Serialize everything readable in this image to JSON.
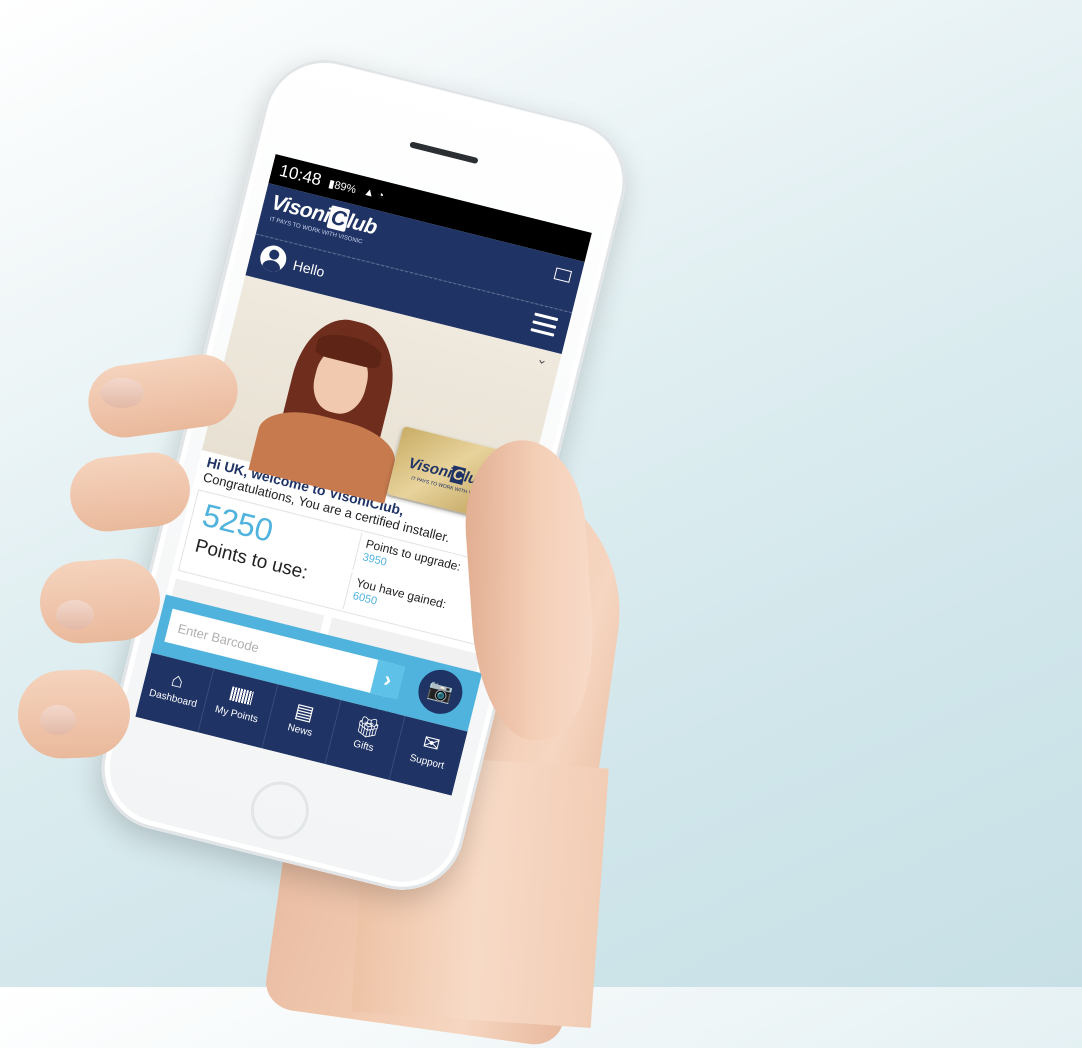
{
  "status_bar": {
    "time": "10:48",
    "battery": "89%"
  },
  "app": {
    "logo_pre": "Visoni",
    "logo_c": "C",
    "logo_post": "lub",
    "tagline": "IT PAYS TO WORK WITH VISONIC"
  },
  "header": {
    "greeting": "Hello"
  },
  "card": {
    "logo_pre": "Visoni",
    "logo_c": "C",
    "logo_post": "lub",
    "tagline": "IT PAYS TO WORK WITH VISONIC"
  },
  "welcome": {
    "title": "Hi UK, welcome to VisoniClub,",
    "subtitle": "Congratulations, You are a certified installer."
  },
  "points": {
    "to_use_value": "5250",
    "to_use_label": "Points to use:",
    "upgrade_label": "Points to upgrade:",
    "upgrade_value": "3950",
    "gained_label": "You have gained:",
    "gained_value": "6050"
  },
  "barcode": {
    "placeholder": "Enter Barcode",
    "go_glyph": "›",
    "camera_glyph": "📷"
  },
  "tabs": [
    {
      "label": "Dashboard",
      "icon": "home-icon"
    },
    {
      "label": "My Points",
      "icon": "barcode-icon"
    },
    {
      "label": "News",
      "icon": "newspaper-icon"
    },
    {
      "label": "Gifts",
      "icon": "gift-icon"
    },
    {
      "label": "Support",
      "icon": "mail-icon"
    }
  ],
  "colors": {
    "navy": "#1f3365",
    "accent_blue": "#4fb3dd"
  }
}
